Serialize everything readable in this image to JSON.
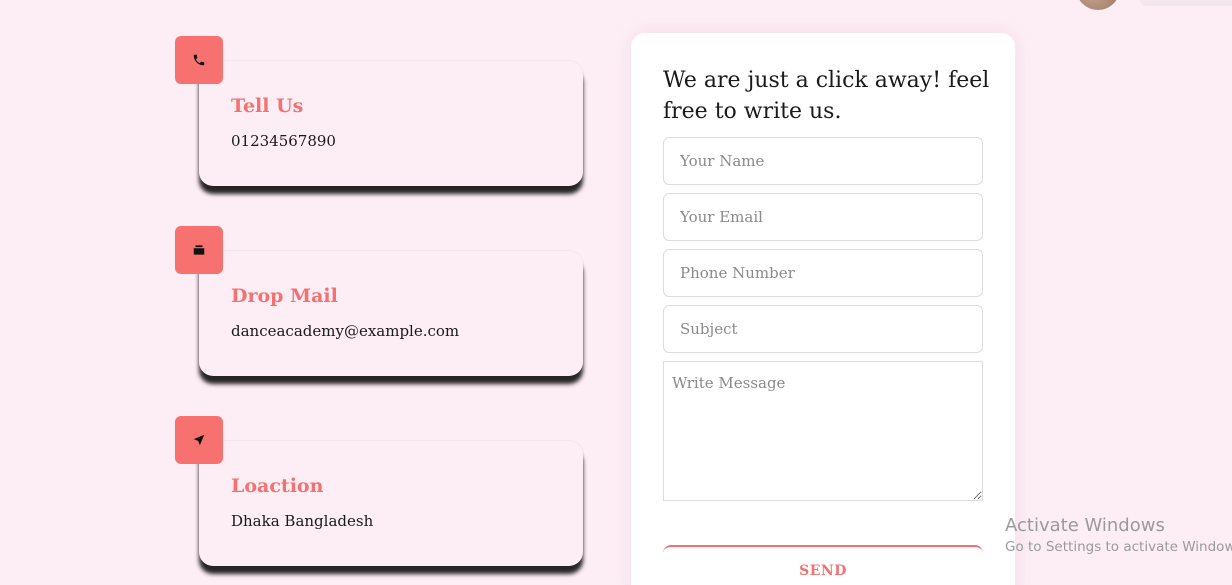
{
  "contact_cards": [
    {
      "icon": "phone-icon",
      "title": "Tell Us",
      "value": "01234567890"
    },
    {
      "icon": "mail-icon",
      "title": "Drop Mail",
      "value": "danceacademy@example.com"
    },
    {
      "icon": "location-arrow-icon",
      "title": "Loaction",
      "value": "Dhaka Bangladesh"
    }
  ],
  "form": {
    "heading": "We are just a click away! feel free to write us.",
    "name_placeholder": "Your Name",
    "email_placeholder": "Your Email",
    "phone_placeholder": "Phone Number",
    "subject_placeholder": "Subject",
    "message_placeholder": "Write Message",
    "send_label": "SEND"
  },
  "watermark": {
    "title": "Activate Windows",
    "subtitle": "Go to Settings to activate Windows."
  },
  "colors": {
    "page_background": "#fdeef5",
    "accent": "#f27171",
    "badge": "#f87171",
    "card_background": "#fdeef5",
    "form_background": "#ffffff"
  }
}
